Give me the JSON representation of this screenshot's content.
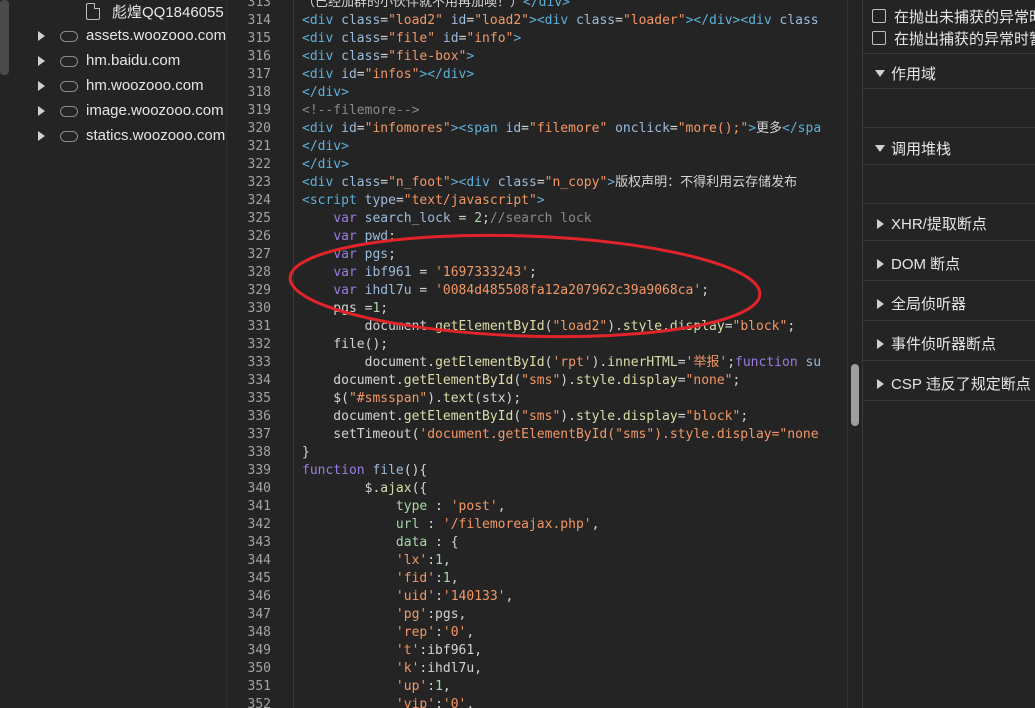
{
  "tree": {
    "file_label": "彪煌QQ1846055",
    "domains": [
      "assets.woozooo.com",
      "hm.baidu.com",
      "hm.woozooo.com",
      "image.woozooo.com",
      "statics.woozooo.com"
    ]
  },
  "code": {
    "lines": [
      {
        "n": "313",
        "html": "<span class=\"p\">（已经加群的小伙伴就不用再加噢！）</span><span class=\"tag\">&lt;/div&gt;</span>"
      },
      {
        "n": "314",
        "html": "<span class=\"tag\">&lt;div </span><span class=\"at\">class</span>=<span class=\"s\">\"load2\"</span> <span class=\"at\">id</span>=<span class=\"s\">\"load2\"</span><span class=\"tag\">&gt;&lt;div </span><span class=\"at\">class</span>=<span class=\"s\">\"loader\"</span><span class=\"tag\">&gt;&lt;/div&gt;&lt;div </span><span class=\"at\">class</span>"
      },
      {
        "n": "315",
        "html": "<span class=\"tag\">&lt;div </span><span class=\"at\">class</span>=<span class=\"s\">\"file\"</span> <span class=\"at\">id</span>=<span class=\"s\">\"info\"</span><span class=\"tag\">&gt;</span>"
      },
      {
        "n": "316",
        "html": "<span class=\"tag\">&lt;div </span><span class=\"at\">class</span>=<span class=\"s\">\"file-box\"</span><span class=\"tag\">&gt;</span>"
      },
      {
        "n": "317",
        "html": "<span class=\"tag\">&lt;div </span><span class=\"at\">id</span>=<span class=\"s\">\"infos\"</span><span class=\"tag\">&gt;&lt;/div&gt;</span>"
      },
      {
        "n": "318",
        "html": "<span class=\"tag\">&lt;/div&gt;</span>"
      },
      {
        "n": "319",
        "html": "<span class=\"cm\">&lt;!--filemore--&gt;</span>"
      },
      {
        "n": "320",
        "html": "<span class=\"tag\">&lt;div </span><span class=\"at\">id</span>=<span class=\"s\">\"infomores\"</span><span class=\"tag\">&gt;&lt;span </span><span class=\"at\">id</span>=<span class=\"s\">\"filemore\"</span> <span class=\"at\">onclick</span>=<span class=\"s\">\"more();\"</span><span class=\"tag\">&gt;</span>更多<span class=\"tag\">&lt;/spa</span>"
      },
      {
        "n": "321",
        "html": "<span class=\"tag\">&lt;/div&gt;</span>"
      },
      {
        "n": "322",
        "html": "<span class=\"tag\">&lt;/div&gt;</span>"
      },
      {
        "n": "323",
        "html": "<span class=\"tag\">&lt;div </span><span class=\"at\">class</span>=<span class=\"s\">\"n_foot\"</span><span class=\"tag\">&gt;&lt;div </span><span class=\"at\">class</span>=<span class=\"s\">\"n_copy\"</span><span class=\"tag\">&gt;</span>版权声明：不得利用云存储发布"
      },
      {
        "n": "324",
        "html": "<span class=\"tag\">&lt;script </span><span class=\"at\">type</span>=<span class=\"s\">\"text/javascript\"</span><span class=\"tag\">&gt;</span>"
      },
      {
        "n": "325",
        "html": "    <span class=\"kw\">var</span> <span class=\"vr\">search_lock</span> = <span class=\"nm\">2</span>;<span class=\"cm\">//search lock</span>"
      },
      {
        "n": "326",
        "html": "    <span class=\"kw\">var</span> <span class=\"vr\">pwd</span>;"
      },
      {
        "n": "327",
        "html": "    <span class=\"kw\">var</span> <span class=\"vr\">pgs</span>;"
      },
      {
        "n": "328",
        "html": "    <span class=\"kw\">var</span> <span class=\"vr\">ibf961</span> = <span class=\"s\">'1697333243'</span>;"
      },
      {
        "n": "329",
        "html": "    <span class=\"kw\">var</span> <span class=\"vr\">ihdl7u</span> = <span class=\"s\">'0084d485508fa12a207962c39a9068ca'</span>;"
      },
      {
        "n": "330",
        "html": "    pgs =<span class=\"nm\">1</span>;"
      },
      {
        "n": "331",
        "html": "        document.<span class=\"fn\">getElementById</span>(<span class=\"s\">\"load2\"</span>).<span class=\"fn\">style</span>.<span class=\"fn\">display</span>=<span class=\"s\">\"block\"</span>;"
      },
      {
        "n": "332",
        "html": "    file();"
      },
      {
        "n": "333",
        "html": "        document.<span class=\"fn\">getElementById</span>(<span class=\"s\">'rpt'</span>).<span class=\"fn\">innerHTML</span>=<span class=\"s\">'举报'</span>;<span class=\"kw\">function</span> <span class=\"vr\">su</span>"
      },
      {
        "n": "334",
        "html": "    document.<span class=\"fn\">getElementById</span>(<span class=\"s\">\"sms\"</span>).<span class=\"fn\">style</span>.<span class=\"fn\">display</span>=<span class=\"s\">\"none\"</span>;"
      },
      {
        "n": "335",
        "html": "    $(<span class=\"s\">\"#smsspan\"</span>).<span class=\"fn\">text</span>(stx);"
      },
      {
        "n": "336",
        "html": "    document.<span class=\"fn\">getElementById</span>(<span class=\"s\">\"sms\"</span>).<span class=\"fn\">style</span>.<span class=\"fn\">display</span>=<span class=\"s\">\"block\"</span>;"
      },
      {
        "n": "337",
        "html": "    setTimeout(<span class=\"s\">'document.getElementById(\"sms\").style.display=\"none</span>"
      },
      {
        "n": "338",
        "html": "}"
      },
      {
        "n": "339",
        "html": "<span class=\"kw\">function</span> <span class=\"vr\">file</span>(){"
      },
      {
        "n": "340",
        "html": "        $.<span class=\"fn\">ajax</span>({"
      },
      {
        "n": "341",
        "html": "            <span class=\"nm\">type</span> : <span class=\"s\">'post'</span>,"
      },
      {
        "n": "342",
        "html": "            <span class=\"nm\">url</span> : <span class=\"s\">'/filemoreajax.php'</span>,"
      },
      {
        "n": "343",
        "html": "            <span class=\"nm\">data</span> : {"
      },
      {
        "n": "344",
        "html": "            <span class=\"s\">'lx'</span>:<span class=\"nm\">1</span>,"
      },
      {
        "n": "345",
        "html": "            <span class=\"s\">'fid'</span>:<span class=\"nm\">1</span>,"
      },
      {
        "n": "346",
        "html": "            <span class=\"s\">'uid'</span>:<span class=\"s\">'140133'</span>,"
      },
      {
        "n": "347",
        "html": "            <span class=\"s\">'pg'</span>:pgs,"
      },
      {
        "n": "348",
        "html": "            <span class=\"s\">'rep'</span>:<span class=\"s\">'0'</span>,"
      },
      {
        "n": "349",
        "html": "            <span class=\"s\">'t'</span>:ibf961,"
      },
      {
        "n": "350",
        "html": "            <span class=\"s\">'k'</span>:ihdl7u,"
      },
      {
        "n": "351",
        "html": "            <span class=\"s\">'up'</span>:<span class=\"nm\">1</span>,"
      },
      {
        "n": "352",
        "html": "            <span class=\"s\">'vip'</span>:<span class=\"s\">'0'</span>,"
      }
    ]
  },
  "panel": {
    "checkbox_uncaught": "在抛出未捕获的异常时",
    "checkbox_caught": "在抛出捕获的异常时暂",
    "scope": "作用域",
    "callstack": "调用堆栈",
    "xhr": "XHR/提取断点",
    "dom": "DOM 断点",
    "global": "全局侦听器",
    "event": "事件侦听器断点",
    "csp": "CSP 违反了规定断点"
  },
  "colors": {
    "annotation": "#e0242a"
  }
}
